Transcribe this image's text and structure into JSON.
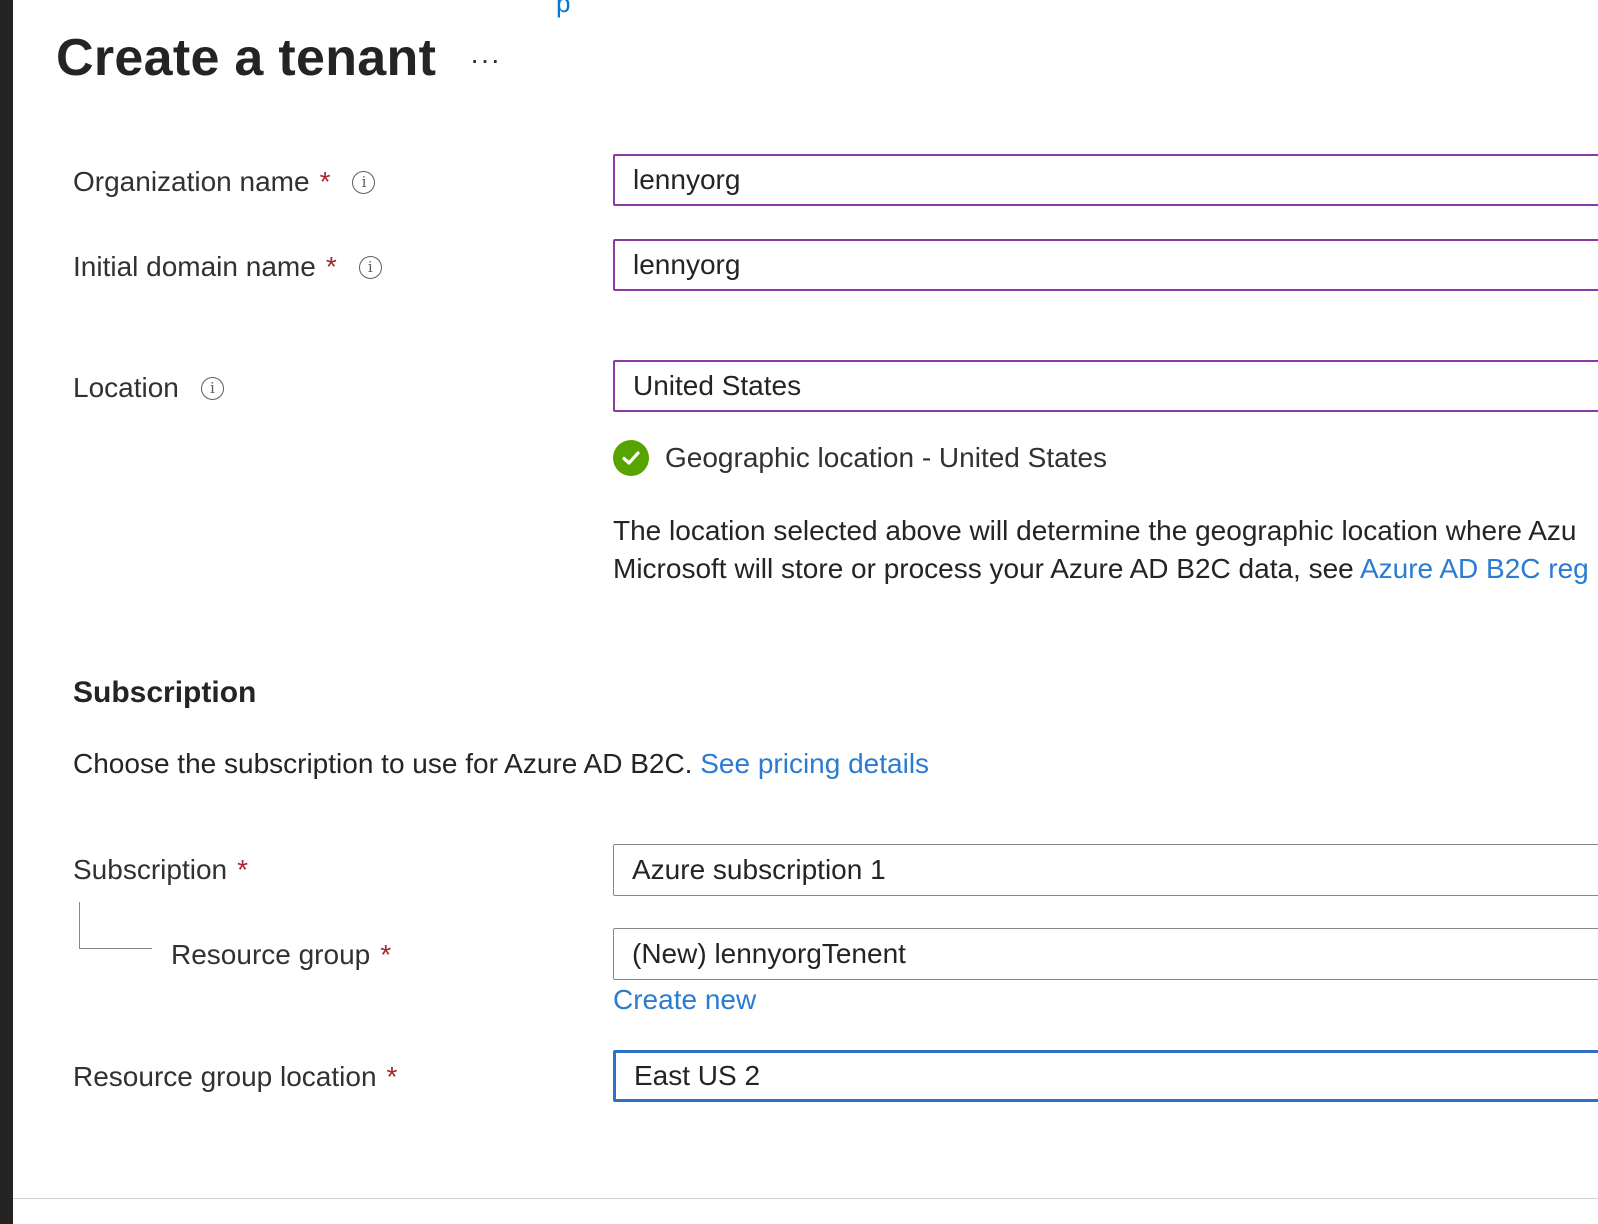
{
  "page": {
    "title": "Create a tenant",
    "more_label": "···",
    "top_link_fragment": "p"
  },
  "form": {
    "organization": {
      "label": "Organization name",
      "required": "*",
      "value": "lennyorg"
    },
    "domain": {
      "label": "Initial domain name",
      "required": "*",
      "value": "lennyorg"
    },
    "location": {
      "label": "Location",
      "value": "United States",
      "status": "Geographic location - United States",
      "desc_line1": "The location selected above will determine the geographic location where Azu",
      "desc_line2_text": "Microsoft will store or process your Azure AD B2C data, see ",
      "desc_line2_link": "Azure AD B2C reg"
    }
  },
  "subscription_section": {
    "heading": "Subscription",
    "desc_text": "Choose the subscription to use for Azure AD B2C. ",
    "desc_link": "See pricing details",
    "subscription": {
      "label": "Subscription",
      "required": "*",
      "value": "Azure subscription 1"
    },
    "resource_group": {
      "label": "Resource group",
      "required": "*",
      "value": "(New) lennyorgTenent",
      "create_new": "Create new"
    },
    "rg_location": {
      "label": "Resource group location",
      "required": "*",
      "value": "East US 2"
    }
  },
  "icons": {
    "info": "info-icon",
    "success": "check-circle-icon"
  },
  "colors": {
    "accent": "#2b7bd2",
    "required": "#a4262c",
    "success": "#57a300",
    "field_border_active": "#8a3aa2",
    "focus_border": "#2f6fc5"
  }
}
